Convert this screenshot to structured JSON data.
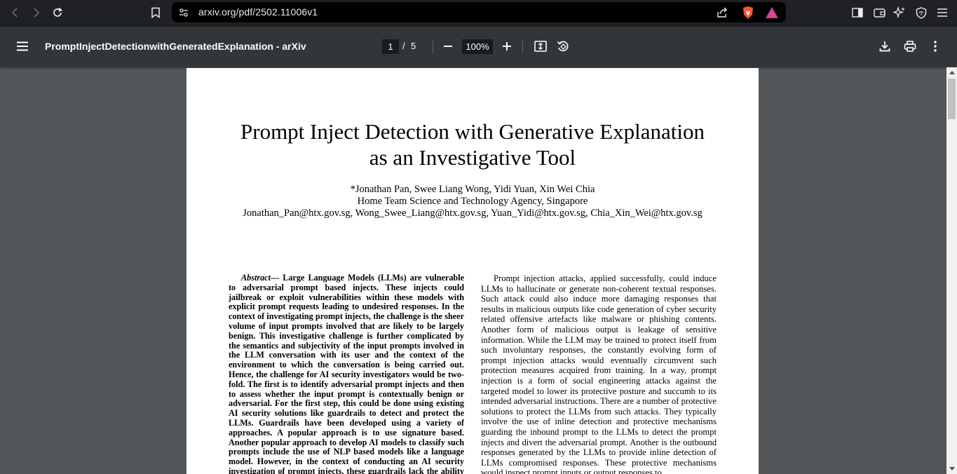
{
  "browser": {
    "url": "arxiv.org/pdf/2502.11006v1"
  },
  "toolbar": {
    "doc_title": "PromptInjectDetectionwithGeneratedExplanation - arXiv",
    "page_current": "1",
    "page_sep": "/",
    "page_total": "5",
    "zoom": "100%"
  },
  "paper": {
    "title_line1": "Prompt Inject Detection with Generative Explanation",
    "title_line2": "as an Investigative Tool",
    "authors": "*Jonathan Pan, Swee Liang Wong, Yidi Yuan, Xin Wei Chia",
    "affiliation": "Home Team Science and Technology Agency, Singapore",
    "emails": "Jonathan_Pan@htx.gov.sg, Wong_Swee_Liang@htx.gov.sg, Yuan_Yidi@htx.gov.sg, Chia_Xin_Wei@htx.gov.sg",
    "abstract_lead": "Abstract",
    "abstract_body": "— Large Language Models (LLMs) are vulnerable to adversarial prompt based injects. These injects could jailbreak or exploit vulnerabilities within these models with explicit prompt requests leading to undesired responses. In the context of investigating prompt injects, the challenge is the sheer volume of input prompts involved that are likely to be largely benign. This investigative challenge is further complicated by the semantics and subjectivity of the input prompts involved in the LLM conversation with its user and the context of the environment to which the conversation is being carried out. Hence, the challenge for AI security investigators would be two-fold. The first is to identify adversarial prompt injects and then to assess whether the input prompt is contextually benign or adversarial. For the first step, this could be done using existing AI security solutions like guardrails to detect and protect the LLMs. Guardrails have been developed using a variety of approaches. A popular approach is to use signature based. Another popular approach to develop AI models to classify such prompts include the use of NLP based models like a language model. However, in the context of conducting an AI security investigation of prompt injects, these guardrails lack the ability to aid investigators in triaging or",
    "right_col": "Prompt injection attacks, applied successfully, could induce LLMs to hallucinate or generate non-coherent textual responses. Such attack could also induce more damaging responses that results in malicious outputs like code generation of cyber security related offensive artefacts like malware or phishing contents. Another form of malicious output is leakage of sensitive information. While the LLM may be trained to protect itself from such involuntary responses, the constantly evolving form of prompt injection attacks would eventually circumvent such protection measures acquired from training. In a way, prompt injection is a form of social engineering attacks against the targeted model to lower its protective posture and succumb to its intended adversarial instructions. There are a number of protective solutions to protect the LLMs from such attacks. They typically involve the use of inline detection and protective mechanisms guarding the inbound prompt to the LLMs to detect the prompt injects and divert the adversarial prompt. Another is the outbound responses generated by the LLMs to provide inline detection of LLMs compromised responses. These protective mechanisms would inspect prompt inputs or output responses to"
  },
  "icons": {
    "back": "back-arrow-icon",
    "forward": "forward-arrow-icon",
    "reload": "reload-icon",
    "bookmark": "bookmark-icon",
    "site_info": "site-settings-icon",
    "share": "share-icon",
    "brave": "brave-shields-icon",
    "rewards": "brave-rewards-icon",
    "sidebar": "sidebar-icon",
    "wallet": "wallet-icon",
    "leo": "leo-ai-icon",
    "vpn": "vpn-shield-icon",
    "menu": "menu-icon",
    "pdf_menu": "hamburger-icon",
    "zoom_out": "minus-icon",
    "zoom_in": "plus-icon",
    "fit": "fit-to-page-icon",
    "rotate": "rotate-icon",
    "download": "download-icon",
    "print": "print-icon",
    "more": "more-vertical-icon"
  },
  "colors": {
    "brave_orange": "#fb542b",
    "rewards_purple": "#a741e5",
    "viewer_bg": "#525659",
    "toolbar_bg": "#323639"
  }
}
